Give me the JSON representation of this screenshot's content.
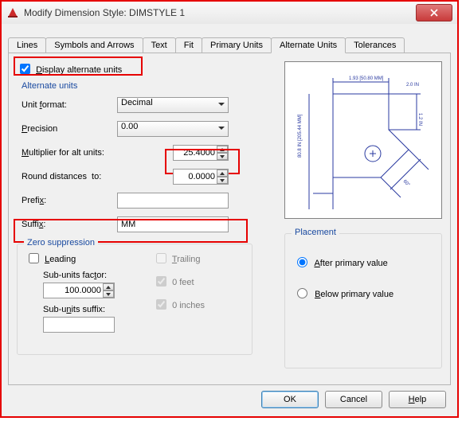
{
  "window": {
    "title": "Modify Dimension Style: DIMSTYLE 1"
  },
  "tabs": [
    "Lines",
    "Symbols and Arrows",
    "Text",
    "Fit",
    "Primary Units",
    "Alternate Units",
    "Tolerances"
  ],
  "active_tab": "Alternate Units",
  "display_alt": {
    "label": "Display alternate units",
    "checked": true
  },
  "alt_units": {
    "header": "Alternate units",
    "unit_format": {
      "label": "Unit format:",
      "value": "Decimal"
    },
    "precision": {
      "label": "Precision",
      "value": "0.00"
    },
    "multiplier": {
      "label": "Multiplier for alt units:",
      "value": "25.4000"
    },
    "round": {
      "label": "Round distances  to:",
      "value": "0.0000"
    },
    "prefix": {
      "label": "Prefix:",
      "value": ""
    },
    "suffix": {
      "label": "Suffix:",
      "value": "MM"
    }
  },
  "zero": {
    "header": "Zero suppression",
    "leading": {
      "label": "Leading",
      "checked": false
    },
    "trailing": {
      "label": "Trailing",
      "checked": false
    },
    "sub_factor": {
      "label": "Sub-units factor:",
      "value": "100.0000"
    },
    "sub_suffix": {
      "label": "Sub-units suffix:",
      "value": ""
    },
    "feet": {
      "label": "0 feet",
      "checked": true
    },
    "inches": {
      "label": "0 inches",
      "checked": true
    }
  },
  "placement": {
    "header": "Placement",
    "after": {
      "label": "After primary value",
      "selected": true
    },
    "below": {
      "label": "Below primary value",
      "selected": false
    }
  },
  "buttons": {
    "ok": "OK",
    "cancel": "Cancel",
    "help": "Help"
  }
}
